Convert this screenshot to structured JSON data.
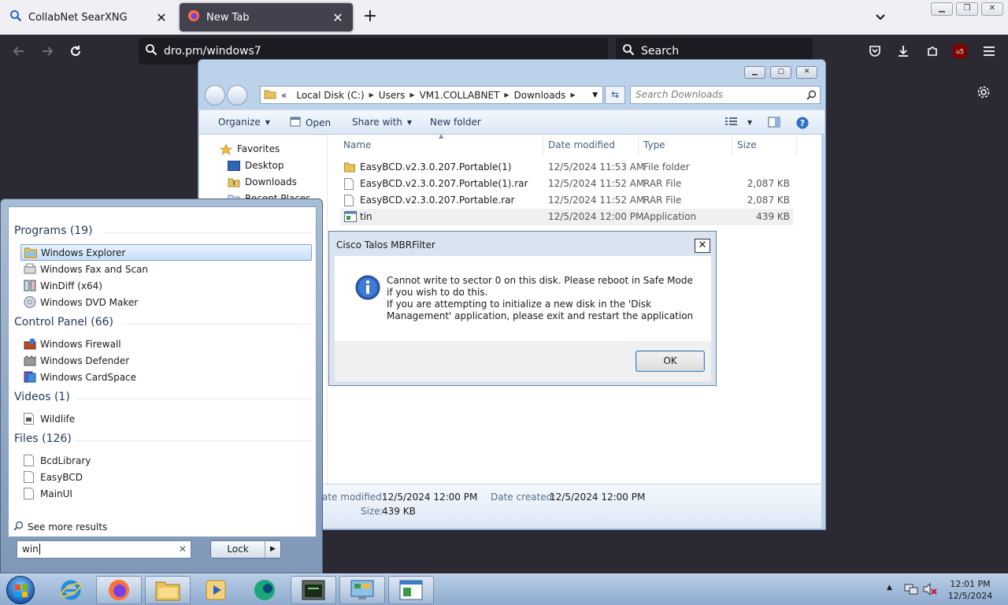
{
  "browser": {
    "tabs": [
      {
        "title": "CollabNet SearXNG",
        "active": false
      },
      {
        "title": "New Tab",
        "active": true
      }
    ],
    "url": "dro.pm/windows7",
    "search_placeholder": "Search",
    "ublock_badge": "u5"
  },
  "explorer": {
    "breadcrumb": [
      "«",
      "Local Disk (C:)",
      "Users",
      "VM1.COLLABNET",
      "Downloads"
    ],
    "search_placeholder": "Search Downloads",
    "toolbar": {
      "organize": "Organize",
      "open": "Open",
      "share_with": "Share with",
      "new_folder": "New folder"
    },
    "nav": {
      "favorites": "Favorites",
      "desktop": "Desktop",
      "downloads": "Downloads",
      "recent_places": "Recent Places"
    },
    "columns": {
      "name": "Name",
      "date": "Date modified",
      "type": "Type",
      "size": "Size"
    },
    "files": [
      {
        "name": "EasyBCD.v2.3.0.207.Portable(1)",
        "date": "12/5/2024 11:53 AM",
        "type": "File folder",
        "size": "",
        "icon": "folder-icon"
      },
      {
        "name": "EasyBCD.v2.3.0.207.Portable(1).rar",
        "date": "12/5/2024 11:52 AM",
        "type": "RAR File",
        "size": "2,087 KB",
        "icon": "file-icon"
      },
      {
        "name": "EasyBCD.v2.3.0.207.Portable.rar",
        "date": "12/5/2024 11:52 AM",
        "type": "RAR File",
        "size": "2,087 KB",
        "icon": "file-icon"
      },
      {
        "name": "tin",
        "date": "12/5/2024 12:00 PM",
        "type": "Application",
        "size": "439 KB",
        "icon": "application-icon"
      }
    ],
    "details": {
      "modified_label": "ate modified:",
      "modified_value": "12/5/2024 12:00 PM",
      "created_label": "Date created:",
      "created_value": "12/5/2024 12:00 PM",
      "size_label": "Size:",
      "size_value": "439 KB"
    }
  },
  "dialog": {
    "title": "Cisco Talos MBRFilter",
    "message_line1": "Cannot write to sector 0 on this disk. Please reboot in Safe Mode if you wish to do this.",
    "message_line2": "If you are attempting to initialize a new disk in the 'Disk Management' application, please exit and restart the application",
    "ok_label": "OK"
  },
  "start_menu": {
    "groups": [
      {
        "title": "Programs (19)",
        "items": [
          "Windows Explorer",
          "Windows Fax and Scan",
          "WinDiff (x64)",
          "Windows DVD Maker"
        ]
      },
      {
        "title": "Control Panel (66)",
        "items": [
          "Windows Firewall",
          "Windows Defender",
          "Windows CardSpace"
        ]
      },
      {
        "title": "Videos (1)",
        "items": [
          "Wildlife"
        ]
      },
      {
        "title": "Files (126)",
        "items": [
          "BcdLibrary",
          "EasyBCD",
          "MainUI"
        ]
      }
    ],
    "see_more": "See more results",
    "search_value": "win",
    "lock_label": "Lock"
  },
  "taskbar": {
    "clock_time": "12:01 PM",
    "clock_date": "12/5/2024"
  },
  "colors": {
    "browser_dark": "#2b2a33",
    "tabbar": "#f0f0f4",
    "explorer_frame": "#bcd1ea",
    "selection": "#c7dff8"
  }
}
